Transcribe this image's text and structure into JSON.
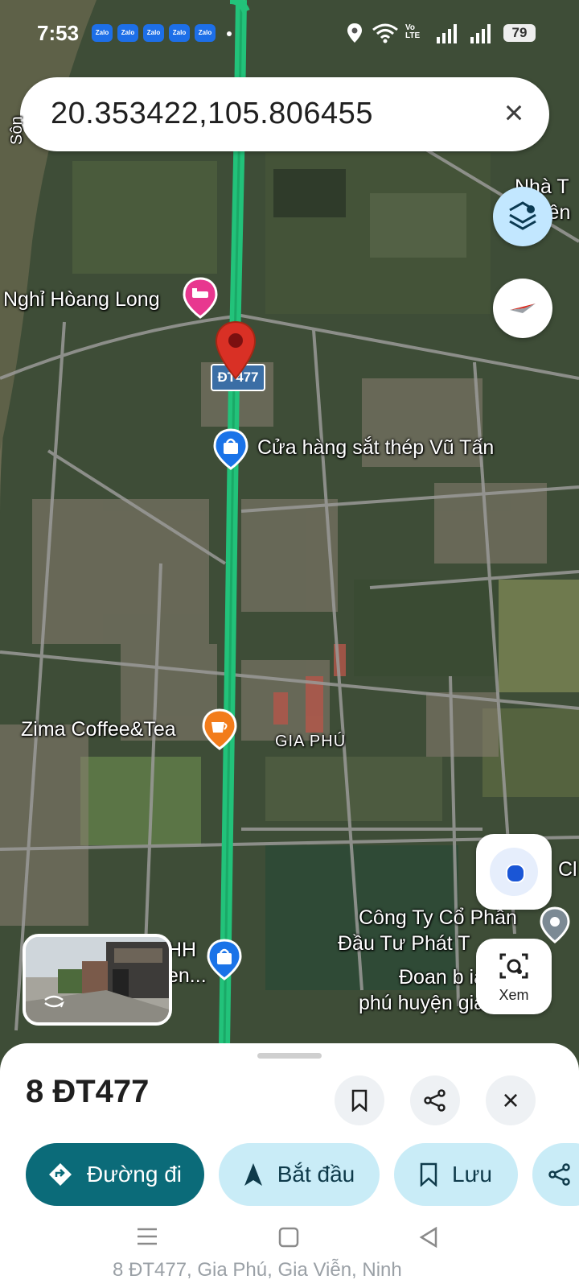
{
  "status_bar": {
    "time": "7:53",
    "app_badges": [
      "Zalo",
      "Zalo",
      "Zalo",
      "Zalo",
      "Zalo"
    ],
    "network": "Vo LTE",
    "battery": "79"
  },
  "search": {
    "query": "20.353422,105.806455"
  },
  "map": {
    "road_shield": "ĐT477",
    "labels": {
      "hotel": "Nghỉ Hòang Long",
      "shop": "Cửa hàng sắt thép Vũ Tấn",
      "cafe": "Zima Coffee&Tea",
      "area": "GIA PHÚ",
      "company_line1": "Công Ty Cổ Phần",
      "company_line2": "Đầu Tư Phát T",
      "youth_line1": "Đoan b      ia",
      "youth_line2": "phú huyện gia viễn...",
      "company_left_line1": "HH",
      "company_left_line2": "en...",
      "top_right_line1": "Nhà T",
      "top_right_line2": "iên",
      "river_label": "Sôn",
      "edge_label": "Cl"
    }
  },
  "lens": {
    "label": "Xem"
  },
  "sheet": {
    "title": "8 ĐT477",
    "address_peek": "8 ĐT477, Gia Phú, Gia Viễn, Ninh",
    "actions": {
      "directions": "Đường đi",
      "start": "Bắt đầu",
      "save": "Lưu"
    }
  },
  "colors": {
    "route_green": "#22c27a",
    "pin_red": "#d93025",
    "primary_button": "#0b6b79",
    "secondary_button": "#c9ecf7",
    "hotel_pin": "#e8378f",
    "shop_pin": "#1a73e8",
    "cafe_pin": "#f27c1b"
  }
}
